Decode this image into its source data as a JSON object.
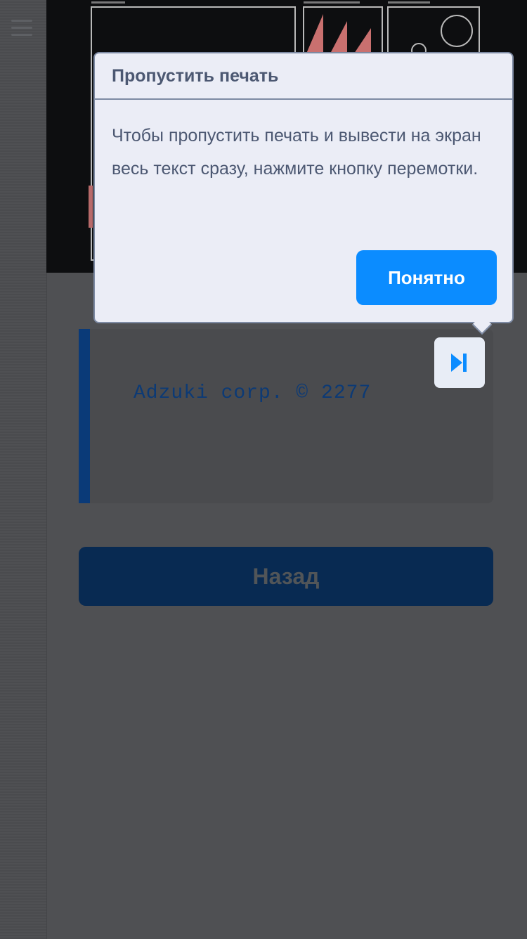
{
  "popover": {
    "title": "Пропустить печать",
    "body": "Чтобы пропустить печать и вывести на экран весь текст сразу, нажмите кнопку перемотки.",
    "ok_label": "Понятно"
  },
  "terminal": {
    "text": "Adzuki corp. © 2277"
  },
  "back_label": "Назад",
  "icons": {
    "menu": "hamburger-menu-icon",
    "skip": "skip-forward-icon"
  },
  "colors": {
    "accent": "#0b8cff",
    "popover_bg": "#ebedf6",
    "popover_text": "#4c5872",
    "terminal_bar": "#0a3a78",
    "back_button": "#082a52",
    "overlay": "#4f5053"
  }
}
